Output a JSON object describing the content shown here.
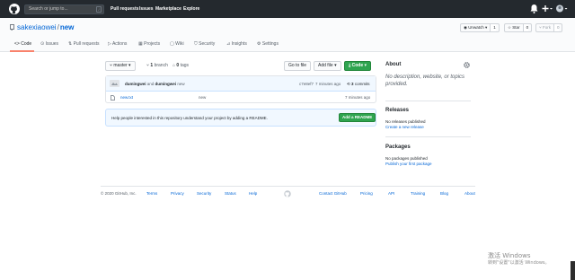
{
  "topbar": {
    "search_placeholder": "Search or jump to...",
    "search_shortcut": "/",
    "nav": [
      "Pull requests",
      "Issues",
      "Marketplace",
      "Explore"
    ]
  },
  "repo": {
    "owner": "sakexiaowei",
    "separator": "/",
    "name": "new",
    "watch_label": "Unwatch",
    "watch_count": "1",
    "star_label": "Star",
    "star_count": "0",
    "fork_label": "Fork",
    "fork_count": "0"
  },
  "tabs": [
    "Code",
    "Issues",
    "Pull requests",
    "Actions",
    "Projects",
    "Wiki",
    "Security",
    "Insights",
    "Settings"
  ],
  "main": {
    "branch": "master",
    "branch_count": "1",
    "branch_word": "branch",
    "tag_count": "0",
    "tag_word": "tags",
    "goto_file": "Go to file",
    "add_file": "Add file",
    "code_btn": "Code",
    "commit": {
      "author": "dumingwei",
      "and": "and",
      "coauthor": "dumingwei",
      "message": "new",
      "sha": "c7e8ef7",
      "time": "7 minutes ago",
      "count": "3",
      "count_word": "commits"
    },
    "files": [
      {
        "name": "new.txt",
        "message": "new",
        "time": "7 minutes ago"
      }
    ],
    "readme_prompt": "Help people interested in this repository understand your project by adding a README.",
    "readme_button": "Add a README"
  },
  "sidebar": {
    "about_title": "About",
    "about_text": "No description, website, or topics provided.",
    "releases_title": "Releases",
    "releases_none": "No releases published",
    "releases_link": "Create a new release",
    "packages_title": "Packages",
    "packages_none": "No packages published",
    "packages_link": "Publish your first package"
  },
  "footer": {
    "copyright": "© 2020 GitHub, Inc.",
    "links_left": [
      "Terms",
      "Privacy",
      "Security",
      "Status",
      "Help"
    ],
    "links_right": [
      "Contact GitHub",
      "Pricing",
      "API",
      "Training",
      "Blog",
      "About"
    ]
  },
  "watermark": {
    "line1": "激活 Windows",
    "line2": "转到\"设置\"以激活 Windows。"
  },
  "colors": {
    "header_bg": "#24292e",
    "link": "#0366d6",
    "green": "#2ea44f",
    "tab_active_underline": "#f9826c"
  }
}
